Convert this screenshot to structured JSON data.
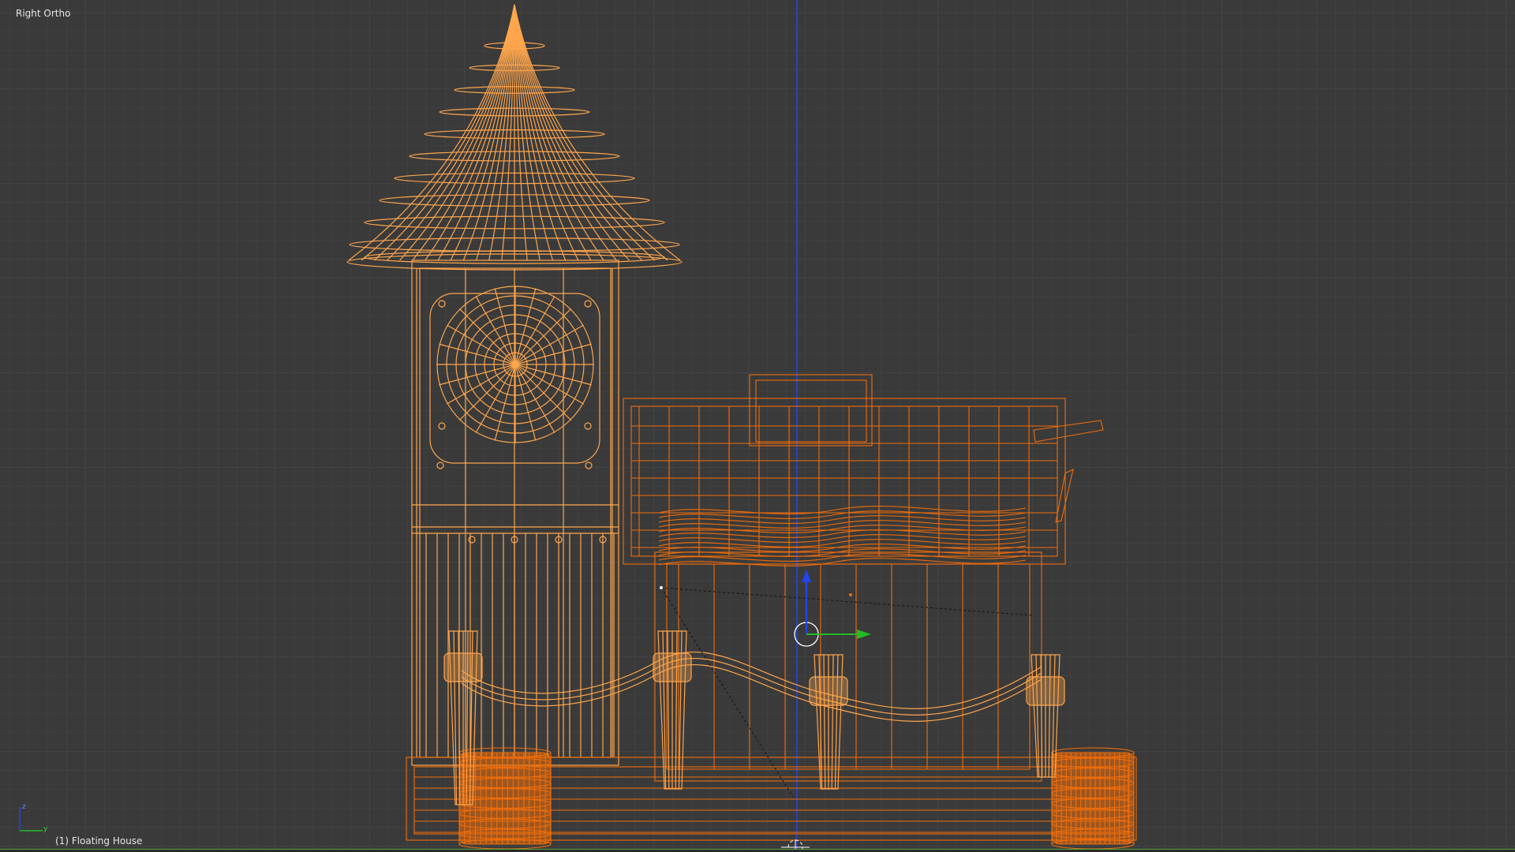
{
  "viewport": {
    "view_name": "Right Ortho",
    "object_info": "(1) Floating House",
    "axis_labels": {
      "z": "z",
      "y": "y"
    }
  },
  "colors": {
    "background": "#3a3a3a",
    "grid": "#434343",
    "wire_active": "#ffa64d",
    "wire_selected": "#f06d0a",
    "axis_z": "#2244ee",
    "axis_y": "#22bb22",
    "ground_line": "#55aa44"
  },
  "icons": {
    "pivot": "circle-widget",
    "move_z": "arrow-up-icon",
    "move_y": "arrow-right-icon",
    "cursor": "3d-cursor-icon"
  }
}
